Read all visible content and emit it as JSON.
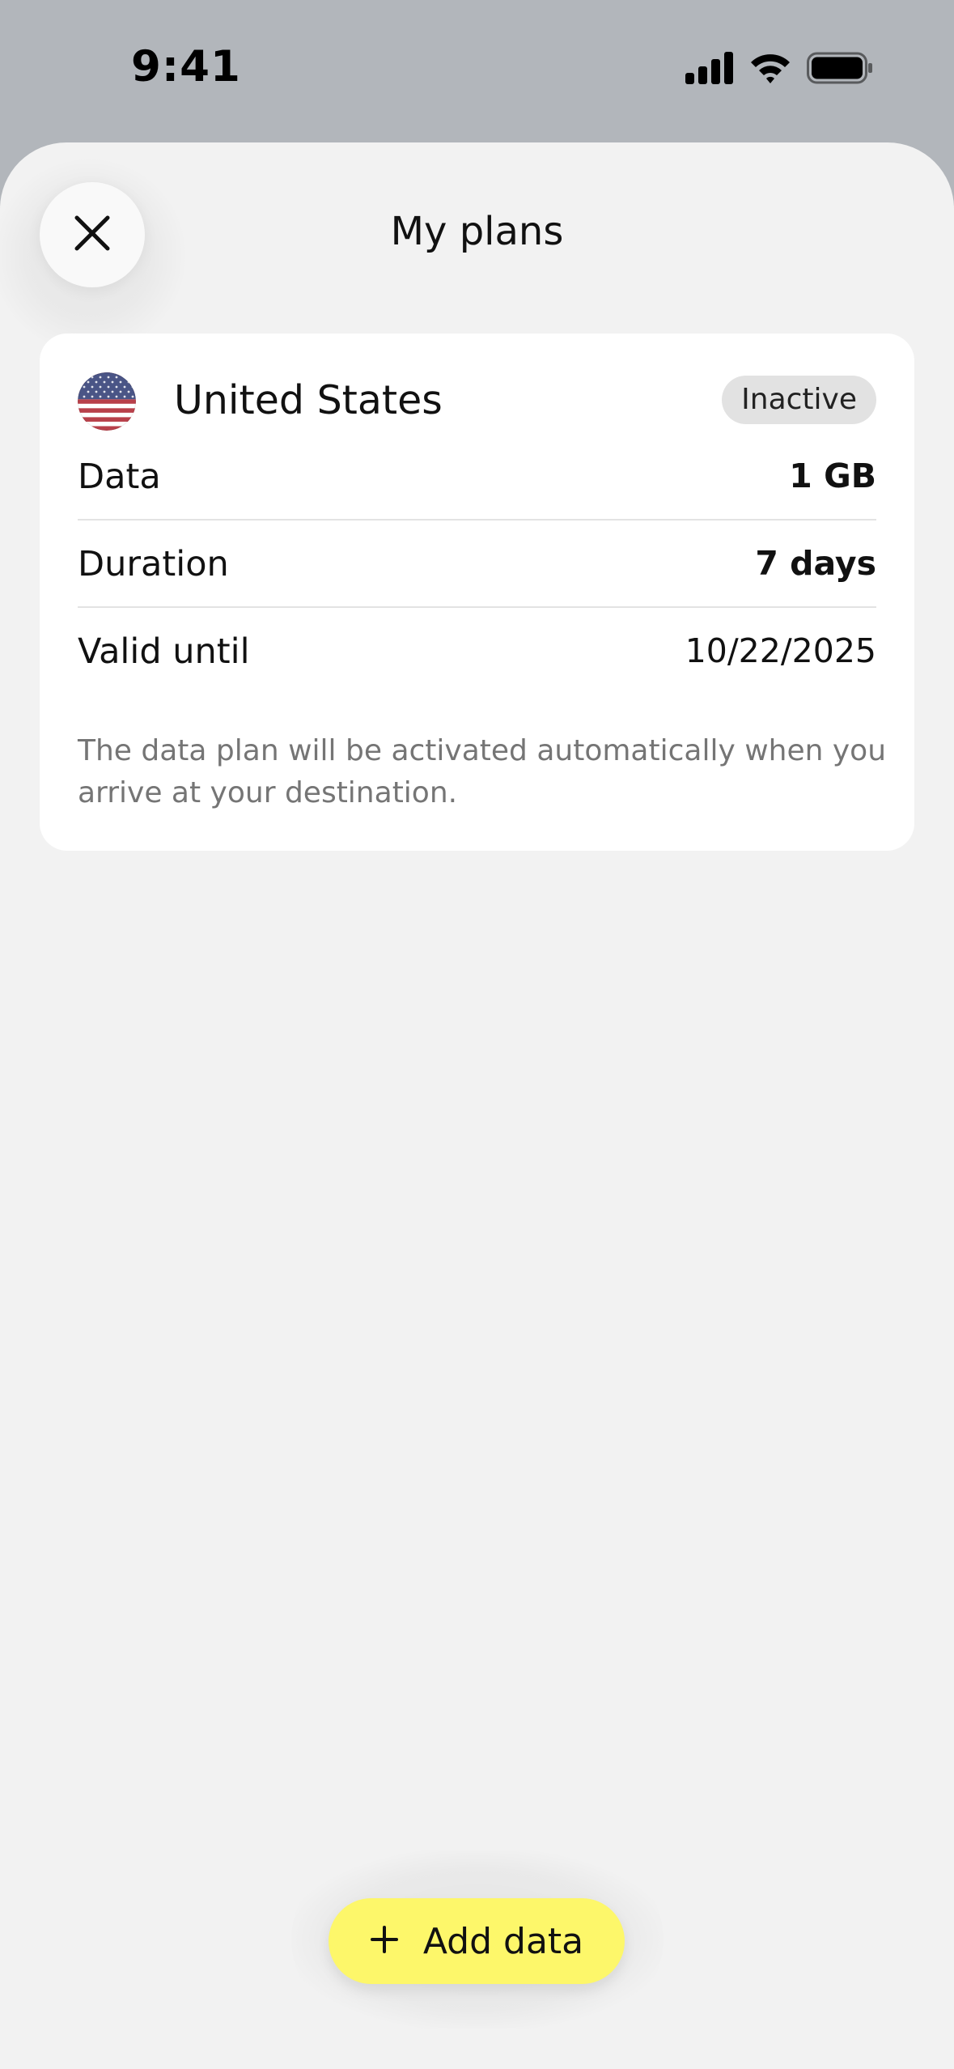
{
  "status_bar": {
    "time": "9:41",
    "icons": [
      "cellular-signal-icon",
      "wifi-icon",
      "battery-icon"
    ]
  },
  "header": {
    "title": "My plans",
    "close_icon": "close-icon"
  },
  "plan": {
    "country": "United States",
    "flag_icon": "us-flag-icon",
    "status": "Inactive",
    "rows": [
      {
        "label": "Data",
        "value": "1 GB"
      },
      {
        "label": "Duration",
        "value": "7 days"
      },
      {
        "label": "Valid until",
        "value": "10/22/2025"
      }
    ],
    "note": "The data plan will be activated automatically when you arrive at your destination."
  },
  "actions": {
    "add_data_label": "Add data",
    "add_icon": "plus-icon"
  },
  "colors": {
    "accent_button": "#fdf76a",
    "sheet_background": "#f2f2f2",
    "card_background": "#ffffff",
    "badge_background": "#e2e2e2",
    "note_text": "#757575"
  }
}
